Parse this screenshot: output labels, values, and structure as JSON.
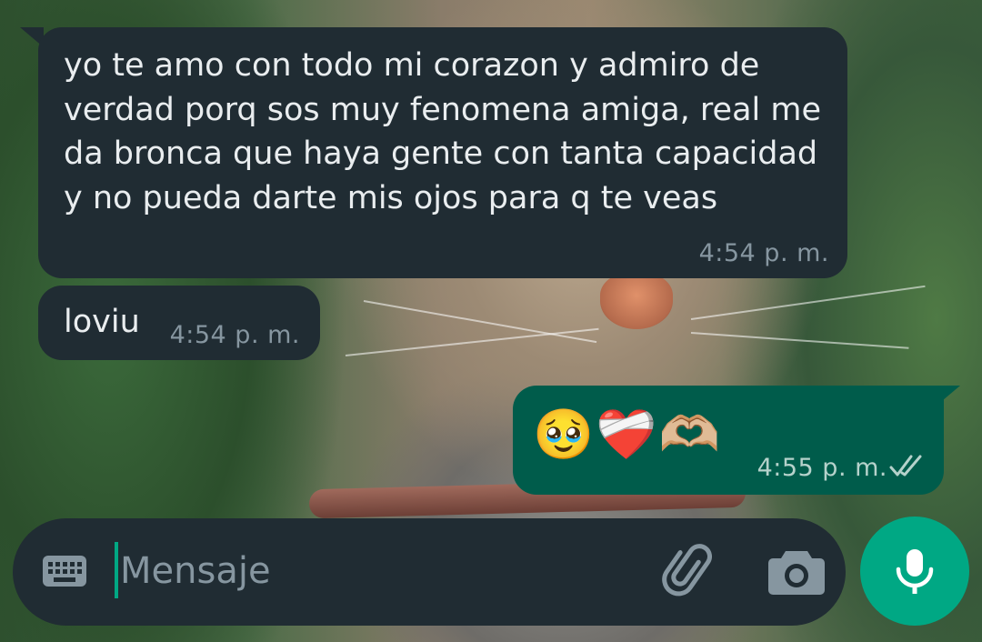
{
  "messages": [
    {
      "direction": "incoming",
      "text": "yo te amo con todo mi corazon y admiro de verdad porq sos muy fenomena amiga, real me da bronca que haya gente con tanta capacidad y no pueda darte mis ojos para q te veas",
      "time": "4:54 p. m."
    },
    {
      "direction": "incoming",
      "text": "loviu",
      "time": "4:54 p. m."
    },
    {
      "direction": "outgoing",
      "text": "🥹❤️‍🩹🫶🏼",
      "time": "4:55 p. m.",
      "status": "read"
    }
  ],
  "composer": {
    "placeholder": "Mensaje",
    "value": "",
    "left_icon": "keyboard-icon",
    "attach_icon": "paperclip-icon",
    "camera_icon": "camera-icon"
  },
  "send_button": {
    "icon": "microphone-icon"
  },
  "colors": {
    "incoming_bubble": "#202c33",
    "outgoing_bubble": "#005c4b",
    "accent": "#00a884",
    "text": "#e9edef",
    "meta": "#8696a0"
  }
}
